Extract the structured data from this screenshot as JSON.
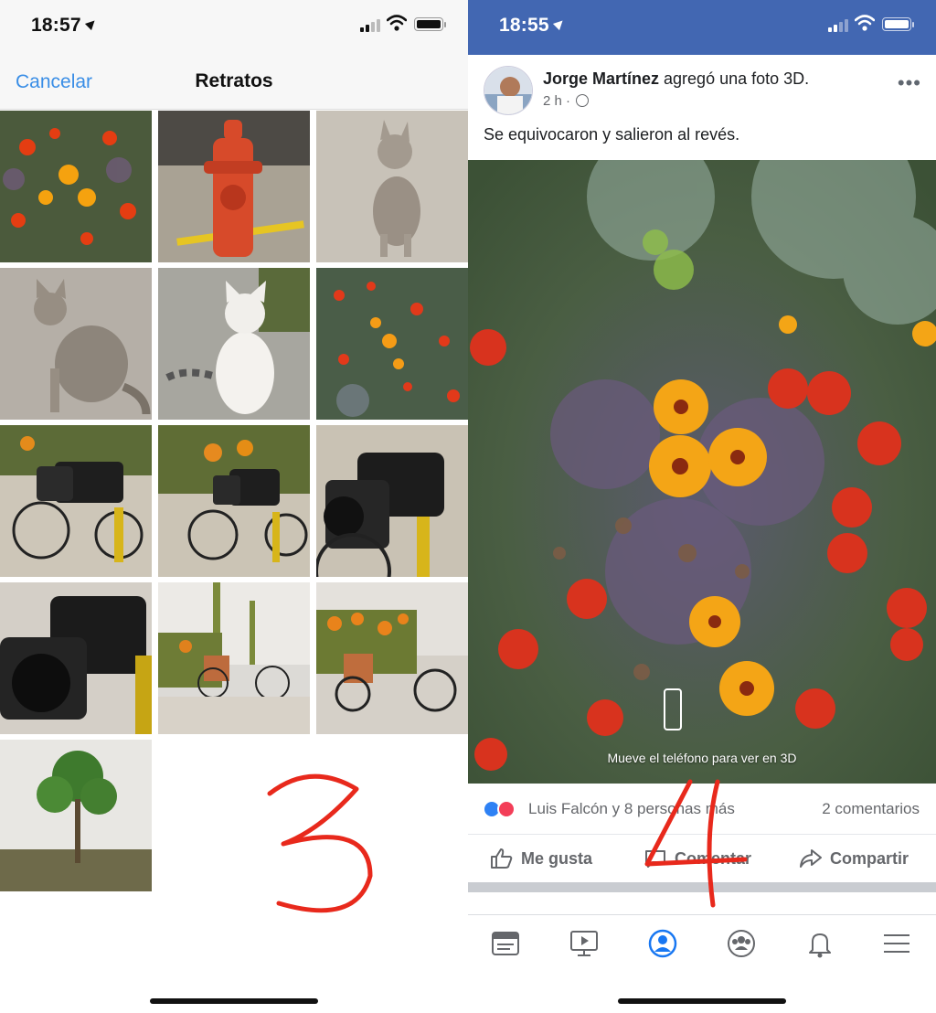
{
  "left_screen": {
    "status_bar": {
      "time": "18:57"
    },
    "nav": {
      "cancel_label": "Cancelar",
      "title": "Retratos"
    },
    "photos": [
      "flowers",
      "fire-hydrant",
      "cat-gray",
      "cat-sitting",
      "cat-white",
      "flowers",
      "camera-bike",
      "camera-bike",
      "camera-closeup",
      "camera-closeup",
      "bike-planter",
      "bike-planter",
      "tree"
    ],
    "annotation": "3"
  },
  "right_screen": {
    "status_bar": {
      "time": "18:55"
    },
    "post": {
      "author": "Jorge Martínez",
      "action": " agregó una foto 3D.",
      "time_ago": "2 h",
      "privacy_icon": "globe-icon",
      "text": "Se equivocaron y salieron al revés.",
      "photo_caption": "Mueve el teléfono para ver en 3D",
      "reactions_label": "Luis Falcón y 8 personas más",
      "comments_label": "2 comentarios",
      "actions": {
        "like": "Me gusta",
        "comment": "Comentar",
        "share": "Compartir"
      }
    },
    "tabbar": [
      "news-feed-icon",
      "watch-icon",
      "profile-icon",
      "groups-icon",
      "notifications-icon",
      "menu-icon"
    ],
    "annotation": "4"
  },
  "colors": {
    "ios_blue": "#3a8ee6",
    "facebook_blue": "#4267b2",
    "annotation_red": "#e8291c"
  }
}
